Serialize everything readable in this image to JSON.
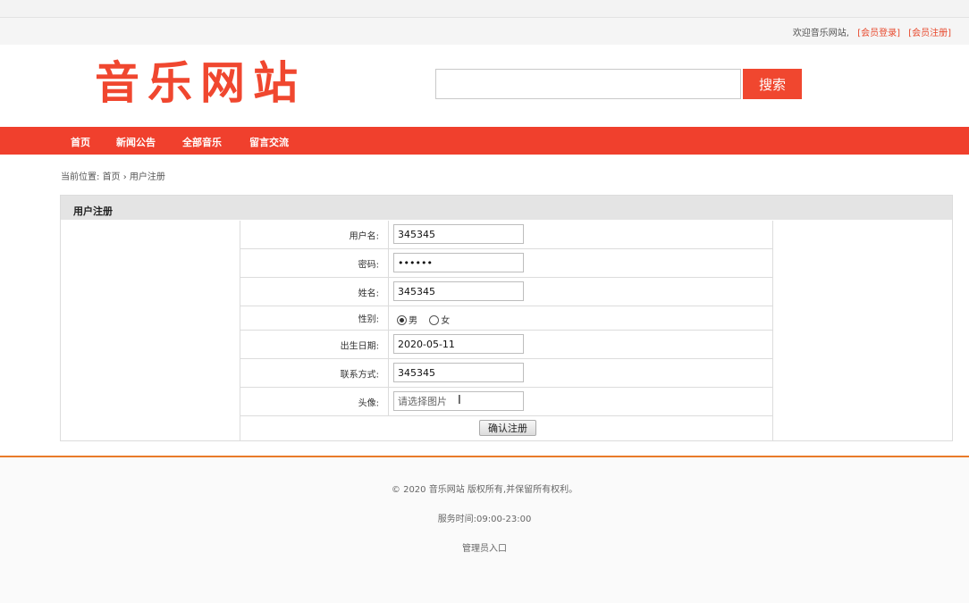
{
  "topbar": {
    "welcome": "欢迎音乐网站,",
    "login_link": "[会员登录]",
    "register_link": "[会员注册]"
  },
  "header": {
    "logo": "音乐网站",
    "search_value": "",
    "search_button": "搜索"
  },
  "nav": {
    "items": [
      "首页",
      "新闻公告",
      "全部音乐",
      "留言交流"
    ]
  },
  "breadcrumb": {
    "prefix": "当前位置: ",
    "home": "首页",
    "separator": " › ",
    "current": "用户注册"
  },
  "panel": {
    "title": "用户注册"
  },
  "form": {
    "username": {
      "label": "用户名:",
      "value": "345345"
    },
    "password": {
      "label": "密码:",
      "value": "345345"
    },
    "name": {
      "label": "姓名:",
      "value": "345345"
    },
    "gender": {
      "label": "性别:",
      "options": [
        "男",
        "女"
      ],
      "selected": "男"
    },
    "birthday": {
      "label": "出生日期:",
      "value": "2020-05-11"
    },
    "contact": {
      "label": "联系方式:",
      "value": "345345"
    },
    "avatar": {
      "label": "头像:",
      "placeholder": "请选择图片"
    },
    "submit_label": "确认注册"
  },
  "footer": {
    "copyright": "© 2020 音乐网站 版权所有,并保留所有权利。",
    "hours": "服务时间:09:00-23:00",
    "admin_link": "管理员入口"
  },
  "colors": {
    "brand": "#f0472f",
    "nav": "#f0402d",
    "divider": "#e97b2a"
  }
}
